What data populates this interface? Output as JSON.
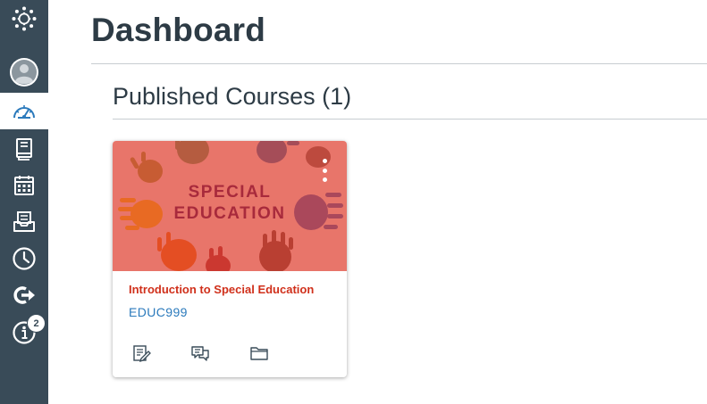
{
  "nav": {
    "logo_icon": "canvas-logo-icon",
    "items": [
      {
        "id": "account",
        "icon": "avatar-icon"
      },
      {
        "id": "dashboard",
        "icon": "dashboard-gauge-icon",
        "active": true
      },
      {
        "id": "courses",
        "icon": "courses-book-icon"
      },
      {
        "id": "calendar",
        "icon": "calendar-icon"
      },
      {
        "id": "inbox",
        "icon": "inbox-tray-icon"
      },
      {
        "id": "history",
        "icon": "clock-icon"
      },
      {
        "id": "commons",
        "icon": "commons-arrow-icon"
      },
      {
        "id": "help",
        "icon": "info-icon",
        "badge": "2"
      }
    ],
    "background": "#394b58",
    "icon_color": "#ffffff",
    "active_icon_color": "#2b7abc"
  },
  "header": {
    "title": "Dashboard"
  },
  "section": {
    "title": "Published Courses (1)"
  },
  "course_card": {
    "hero_text_line1": "SPECIAL",
    "hero_text_line2": "EDUCATION",
    "name": "Introduction to Special Education",
    "code": "EDUC999",
    "name_color": "#d0301b",
    "code_color": "#2b7abc",
    "hero_color": "#e8756a",
    "actions": [
      {
        "id": "assignments",
        "icon": "assignments-edit-icon"
      },
      {
        "id": "discussions",
        "icon": "discussions-chat-icon"
      },
      {
        "id": "files",
        "icon": "folder-icon"
      }
    ]
  }
}
